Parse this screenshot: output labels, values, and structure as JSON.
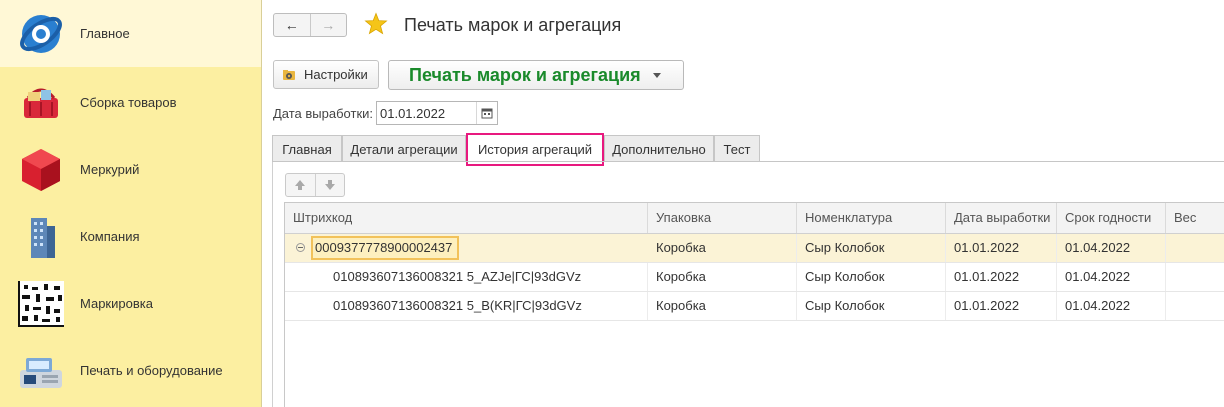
{
  "sidebar": {
    "items": [
      {
        "label": "Главное",
        "icon": "app-logo-icon",
        "active": true
      },
      {
        "label": "Сборка товаров",
        "icon": "shopping-basket-icon",
        "active": false
      },
      {
        "label": "Меркурий",
        "icon": "red-cube-icon",
        "active": false
      },
      {
        "label": "Компания",
        "icon": "building-icon",
        "active": false
      },
      {
        "label": "Маркировка",
        "icon": "qr-code-icon",
        "active": false
      },
      {
        "label": "Печать и оборудование",
        "icon": "cash-register-icon",
        "active": false
      }
    ]
  },
  "header": {
    "back_icon": "←",
    "forward_icon": "→",
    "title": "Печать марок и агрегация"
  },
  "toolbar": {
    "settings_label": "Настройки",
    "print_label": "Печать марок и агрегация"
  },
  "date": {
    "label": "Дата выработки:",
    "value": "01.01.2022"
  },
  "tabs": [
    {
      "label": "Главная",
      "active": false
    },
    {
      "label": "Детали агрегации",
      "active": false
    },
    {
      "label": "История агрегаций",
      "active": true
    },
    {
      "label": "Дополнительно",
      "active": false
    },
    {
      "label": "Тест",
      "active": false
    }
  ],
  "table": {
    "columns": [
      "Штрихкод",
      "Упаковка",
      "Номенклатура",
      "Дата выработки",
      "Срок годности",
      "Вес"
    ],
    "rows": [
      {
        "barcode": "0009377778900002437",
        "pack": "Коробка",
        "item": "Сыр Колобок",
        "prod_date": "01.01.2022",
        "expiry": "01.04.2022",
        "weight": "",
        "group": true
      },
      {
        "barcode": "010893607136008321 5_AZJe|ГС|93dGVz",
        "pack": "Коробка",
        "item": "Сыр Колобок",
        "prod_date": "01.01.2022",
        "expiry": "01.04.2022",
        "weight": ""
      },
      {
        "barcode": "010893607136008321 5_B(KR|ГС|93dGVz",
        "pack": "Коробка",
        "item": "Сыр Колобок",
        "prod_date": "01.01.2022",
        "expiry": "01.04.2022",
        "weight": ""
      }
    ]
  },
  "colors": {
    "sidebar_bg": "#fcefa1",
    "accent_green": "#1a8a2b",
    "active_tab_border": "#e8197f",
    "selected_row": "#fbf3d6"
  }
}
